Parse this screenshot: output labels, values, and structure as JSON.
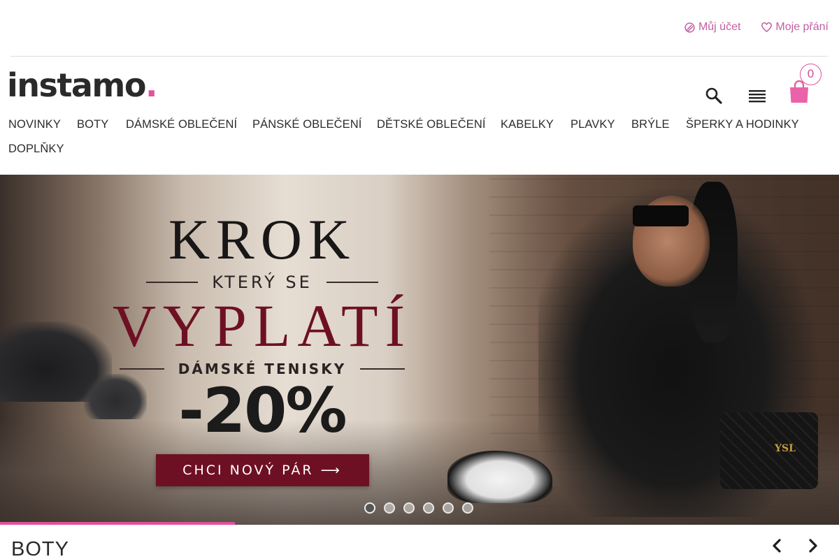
{
  "header": {
    "account_label": "Můj účet",
    "wishlist_label": "Moje přání",
    "logo_text": "instamo",
    "logo_dot": ".",
    "cart_count": "0",
    "colors": {
      "accent": "#e0529c",
      "accent_text": "#c35ea0",
      "banner_red": "#6e1024"
    }
  },
  "nav": {
    "categories": [
      "NOVINKY",
      "BOTY",
      "DÁMSKÉ OBLEČENÍ",
      "PÁNSKÉ OBLEČENÍ",
      "DĚTSKÉ OBLEČENÍ",
      "KABELKY",
      "PLAVKY",
      "BRÝLE",
      "ŠPERKY A HODINKY",
      "DOPLŇKY"
    ]
  },
  "hero": {
    "line1": "KROK",
    "line2": "KTERÝ SE",
    "line3": "VYPLATÍ",
    "line4": "DÁMSKÉ TENISKY",
    "discount": "-20%",
    "cta_label": "CHCI NOVÝ PÁR",
    "cta_arrow": "⟶",
    "bag_logo": "YSL",
    "slide_count": 6,
    "active_slide": 1,
    "autoplay_progress": 0.28
  },
  "section": {
    "title": "BOTY"
  },
  "icons": {
    "account": "account-icon",
    "wishlist": "heart-icon",
    "search": "search-icon",
    "menu": "menu-icon",
    "cart": "shopping-bag-icon",
    "prev": "chevron-left-icon",
    "next": "chevron-right-icon"
  }
}
